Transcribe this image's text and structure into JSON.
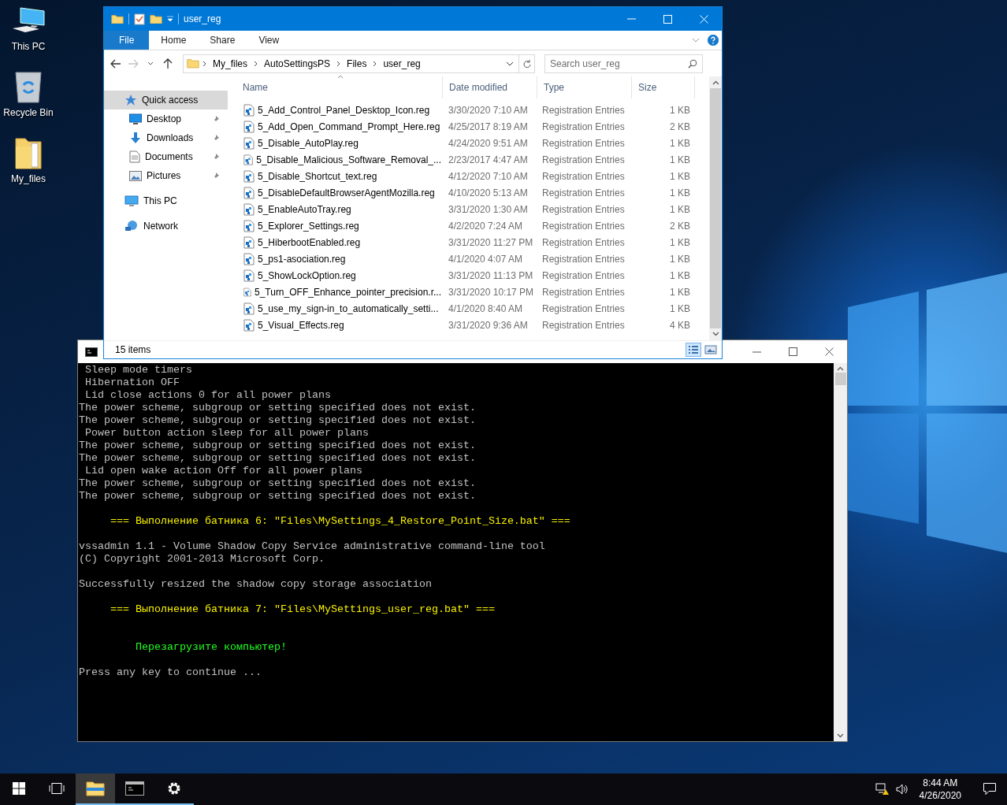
{
  "desktop_icons": [
    {
      "kind": "pc",
      "label": "This PC"
    },
    {
      "kind": "bin",
      "label": "Recycle Bin"
    },
    {
      "kind": "folder",
      "label": "My_files"
    }
  ],
  "explorer": {
    "title": "user_reg",
    "ribbon_tabs": [
      {
        "label": "File",
        "selected": true
      },
      {
        "label": "Home",
        "selected": false
      },
      {
        "label": "Share",
        "selected": false
      },
      {
        "label": "View",
        "selected": false
      }
    ],
    "breadcrumb": [
      "My_files",
      "AutoSettingsPS",
      "Files",
      "user_reg"
    ],
    "search": {
      "placeholder": "Search user_reg"
    },
    "nav": [
      {
        "kind": "star",
        "label": "Quick access",
        "selected": true,
        "pinned": false
      },
      {
        "kind": "desktop",
        "label": "Desktop",
        "selected": false,
        "pinned": true
      },
      {
        "kind": "download",
        "label": "Downloads",
        "selected": false,
        "pinned": true
      },
      {
        "kind": "document",
        "label": "Documents",
        "selected": false,
        "pinned": true
      },
      {
        "kind": "picture",
        "label": "Pictures",
        "selected": false,
        "pinned": true
      },
      {
        "kind": "pc",
        "label": "This PC",
        "selected": false,
        "pinned": false
      },
      {
        "kind": "network",
        "label": "Network",
        "selected": false,
        "pinned": false
      }
    ],
    "columns": [
      "Name",
      "Date modified",
      "Type",
      "Size"
    ],
    "files": [
      {
        "name": "5_Add_Control_Panel_Desktop_Icon.reg",
        "date": "3/30/2020 7:10 AM",
        "type": "Registration Entries",
        "size": "1 KB"
      },
      {
        "name": "5_Add_Open_Command_Prompt_Here.reg",
        "date": "4/25/2017 8:19 AM",
        "type": "Registration Entries",
        "size": "2 KB"
      },
      {
        "name": "5_Disable_AutoPlay.reg",
        "date": "4/24/2020 9:51 AM",
        "type": "Registration Entries",
        "size": "1 KB"
      },
      {
        "name": "5_Disable_Malicious_Software_Removal_...",
        "date": "2/23/2017 4:47 AM",
        "type": "Registration Entries",
        "size": "1 KB"
      },
      {
        "name": "5_Disable_Shortcut_text.reg",
        "date": "4/12/2020 7:10 AM",
        "type": "Registration Entries",
        "size": "1 KB"
      },
      {
        "name": "5_DisableDefaultBrowserAgentMozilla.reg",
        "date": "4/10/2020 5:13 AM",
        "type": "Registration Entries",
        "size": "1 KB"
      },
      {
        "name": "5_EnableAutoTray.reg",
        "date": "3/31/2020 1:30 AM",
        "type": "Registration Entries",
        "size": "1 KB"
      },
      {
        "name": "5_Explorer_Settings.reg",
        "date": "4/2/2020 7:24 AM",
        "type": "Registration Entries",
        "size": "2 KB"
      },
      {
        "name": "5_HiberbootEnabled.reg",
        "date": "3/31/2020 11:27 PM",
        "type": "Registration Entries",
        "size": "1 KB"
      },
      {
        "name": "5_ps1-asociation.reg",
        "date": "4/1/2020 4:07 AM",
        "type": "Registration Entries",
        "size": "1 KB"
      },
      {
        "name": "5_ShowLockOption.reg",
        "date": "3/31/2020 11:13 PM",
        "type": "Registration Entries",
        "size": "1 KB"
      },
      {
        "name": "5_Turn_OFF_Enhance_pointer_precision.r...",
        "date": "3/31/2020 10:17 PM",
        "type": "Registration Entries",
        "size": "1 KB"
      },
      {
        "name": "5_use_my_sign-in_to_automatically_setti...",
        "date": "4/1/2020 8:40 AM",
        "type": "Registration Entries",
        "size": "1 KB"
      },
      {
        "name": "5_Visual_Effects.reg",
        "date": "3/31/2020 9:36 AM",
        "type": "Registration Entries",
        "size": "4 KB"
      }
    ],
    "status": "15 items",
    "views": [
      {
        "kind": "details",
        "selected": true
      },
      {
        "kind": "tiles",
        "selected": false
      }
    ]
  },
  "console": {
    "lines": [
      {
        "kind": "plain",
        "text": " Sleep mode timers"
      },
      {
        "kind": "plain",
        "text": " Hibernation OFF"
      },
      {
        "kind": "plain",
        "text": " Lid close actions 0 for all power plans"
      },
      {
        "kind": "plain",
        "text": "The power scheme, subgroup or setting specified does not exist."
      },
      {
        "kind": "plain",
        "text": "The power scheme, subgroup or setting specified does not exist."
      },
      {
        "kind": "plain",
        "text": " Power button action sleep for all power plans"
      },
      {
        "kind": "plain",
        "text": "The power scheme, subgroup or setting specified does not exist."
      },
      {
        "kind": "plain",
        "text": "The power scheme, subgroup or setting specified does not exist."
      },
      {
        "kind": "plain",
        "text": " Lid open wake action Off for all power plans"
      },
      {
        "kind": "plain",
        "text": "The power scheme, subgroup or setting specified does not exist."
      },
      {
        "kind": "plain",
        "text": "The power scheme, subgroup or setting specified does not exist."
      },
      {
        "kind": "blank"
      },
      {
        "kind": "heading",
        "text": "     === Выполнение батника 6: \"Files\\MySettings_4_Restore_Point_Size.bat\" ==="
      },
      {
        "kind": "blank"
      },
      {
        "kind": "plain",
        "text": "vssadmin 1.1 - Volume Shadow Copy Service administrative command-line tool"
      },
      {
        "kind": "plain",
        "text": "(C) Copyright 2001-2013 Microsoft Corp."
      },
      {
        "kind": "blank"
      },
      {
        "kind": "plain",
        "text": "Successfully resized the shadow copy storage association"
      },
      {
        "kind": "blank"
      },
      {
        "kind": "heading",
        "text": "     === Выполнение батника 7: \"Files\\MySettings_user_reg.bat\" ==="
      },
      {
        "kind": "blank"
      },
      {
        "kind": "blank"
      },
      {
        "kind": "notice",
        "text": "         Перезагрузите компьютер!"
      },
      {
        "kind": "blank"
      },
      {
        "kind": "plain",
        "text": "Press any key to continue ..."
      }
    ]
  },
  "taskbar": {
    "apps": [
      {
        "kind": "explorer",
        "selected": true
      },
      {
        "kind": "console",
        "selected": false
      },
      {
        "kind": "settings",
        "selected": false
      }
    ],
    "time": "8:44 AM",
    "date": "4/26/2020"
  }
}
